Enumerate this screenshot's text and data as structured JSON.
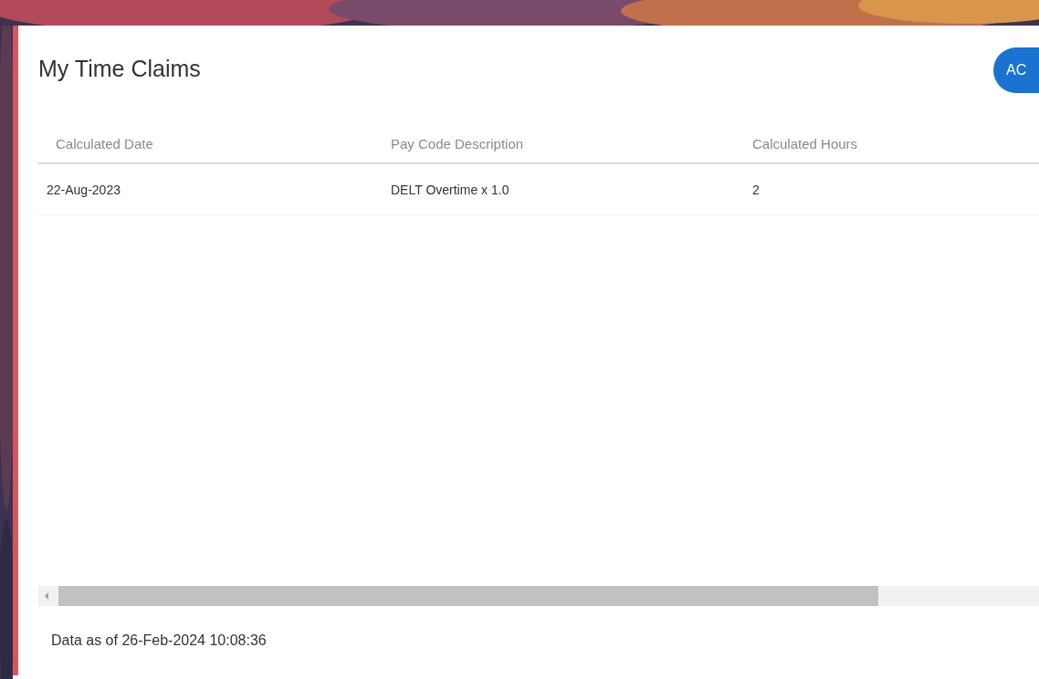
{
  "card": {
    "title": "My Time Claims",
    "action_button": "AC"
  },
  "table": {
    "columns": [
      "Calculated Date",
      "Pay Code Description",
      "Calculated Hours"
    ],
    "rows": [
      [
        "22-Aug-2023",
        "DELT Overtime x 1.0",
        "2"
      ]
    ]
  },
  "footer": "Data as of 26-Feb-2024 10:08:36"
}
